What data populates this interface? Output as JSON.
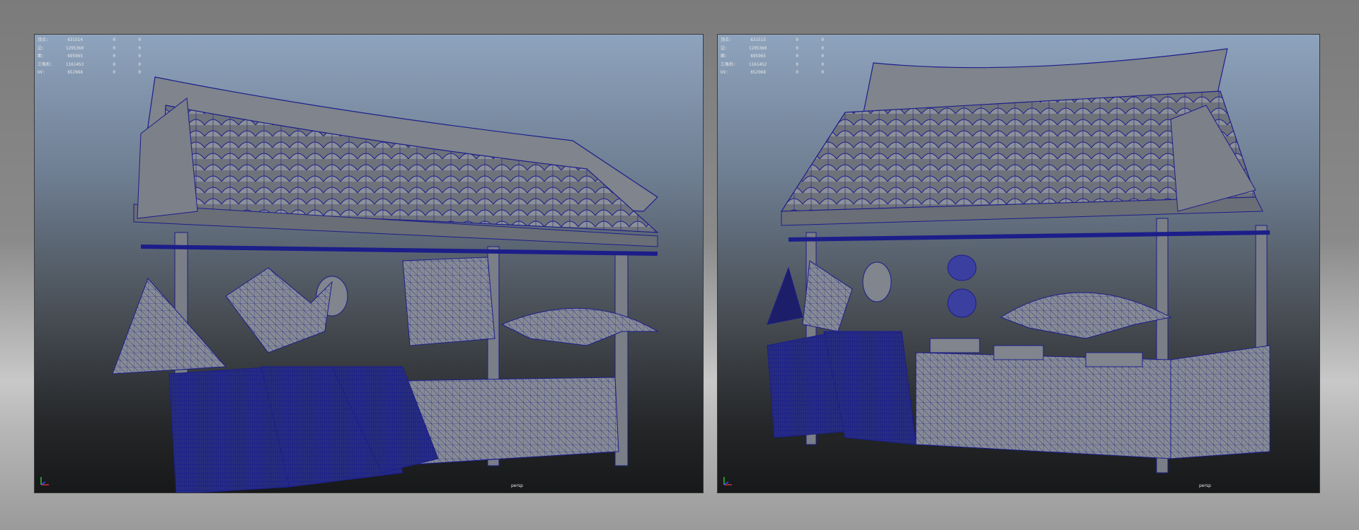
{
  "viewports": [
    {
      "id": "left",
      "camera": "persp",
      "stats": [
        {
          "label": "顶点:",
          "value": "631514",
          "c1": "0",
          "c2": "0"
        },
        {
          "label": "边:",
          "value": "1295360",
          "c1": "0",
          "c2": "0"
        },
        {
          "label": "面:",
          "value": "695965",
          "c1": "0",
          "c2": "0"
        },
        {
          "label": "三角形:",
          "value": "1161453",
          "c1": "0",
          "c2": "0"
        },
        {
          "label": "UV:",
          "value": "652968",
          "c1": "0",
          "c2": "0"
        }
      ]
    },
    {
      "id": "right",
      "camera": "persp",
      "stats": [
        {
          "label": "顶点:",
          "value": "631515",
          "c1": "0",
          "c2": "0"
        },
        {
          "label": "边:",
          "value": "1295360",
          "c1": "0",
          "c2": "0"
        },
        {
          "label": "面:",
          "value": "695965",
          "c1": "0",
          "c2": "0"
        },
        {
          "label": "三角形:",
          "value": "1161452",
          "c1": "0",
          "c2": "0"
        },
        {
          "label": "UV:",
          "value": "652968",
          "c1": "0",
          "c2": "0"
        }
      ]
    }
  ],
  "colors": {
    "wire": "#1c1e8a",
    "mesh": "#8a8f98",
    "meshDark": "#5b5f66"
  }
}
